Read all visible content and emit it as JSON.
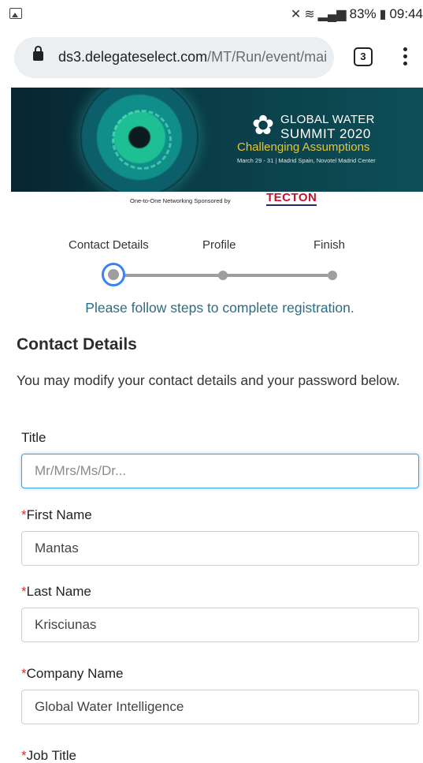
{
  "status_bar": {
    "battery": "83%",
    "time": "09:44",
    "image_icon": "image-icon",
    "mute_icon": "mute-icon",
    "wifi_icon": "wifi-icon",
    "signal_icon": "signal-icon",
    "battery_icon": "battery-icon"
  },
  "browser": {
    "url_host": "ds3.delegateselect.com",
    "url_path": "/MT/Run/event/mai",
    "tab_count": "3"
  },
  "banner": {
    "title_line1": "GLOBAL WATER",
    "title_line2": "SUMMIT 2020",
    "tagline": "Challenging Assumptions",
    "date_venue": "March 29 - 31  |  Madrid Spain, Novotel Madrid Center",
    "sponsor_text": "One-to-One Networking Sponsored by",
    "sponsor_logo": "TECTON"
  },
  "stepper": {
    "steps": [
      "Contact Details",
      "Profile",
      "Finish"
    ],
    "active_index": 0,
    "instructions": "Please follow steps to complete registration."
  },
  "section": {
    "title": "Contact Details",
    "description": "You may modify your contact details and your password below."
  },
  "form": {
    "title_label": "Title",
    "title_placeholder": "Mr/Mrs/Ms/Dr...",
    "title_value": "",
    "first_name_label": "First Name",
    "first_name_value": "Mantas",
    "last_name_label": "Last Name",
    "last_name_value": "Krisciunas",
    "company_label": "Company Name",
    "company_value": "Global Water Intelligence",
    "job_title_label": "Job Title",
    "required_marker": "*"
  },
  "colors": {
    "accent": "#3b82f6",
    "instruction_text": "#2b6d82",
    "required": "#d32f2f"
  }
}
